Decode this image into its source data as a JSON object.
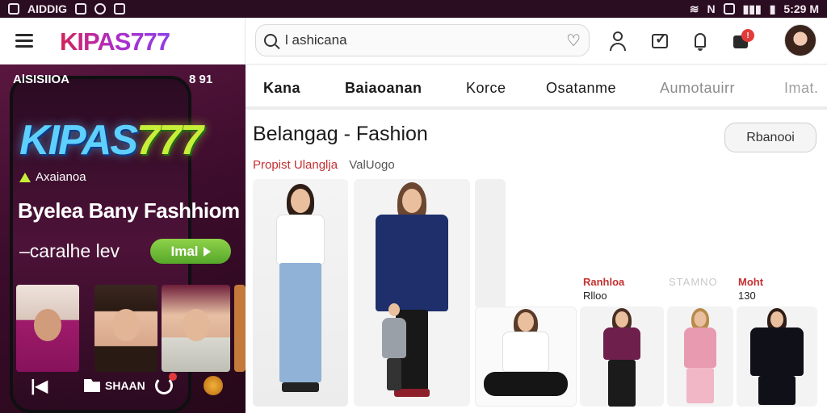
{
  "status_bar": {
    "left_text": "AIDDIG",
    "time": "5:29 M"
  },
  "app": {
    "brand": "KIPAS777"
  },
  "search": {
    "value": "l ashicana",
    "placeholder": ""
  },
  "toolbar": {
    "cart_badge": "!"
  },
  "promo": {
    "phone_label": "AlSISIIOA",
    "phone_time": "8 91",
    "brand_main": "KIPAS",
    "brand_sevens": "777",
    "tagline": "Axaianoa",
    "headline": "Byelea Bany Fashhiom",
    "subline": "–caralhe lev",
    "cta_label": "Imal",
    "share_label": "SHAAN"
  },
  "tabs": [
    {
      "label": "Kana",
      "style": "bold"
    },
    {
      "label": "Baiaoanan",
      "style": "bold"
    },
    {
      "label": "Korce",
      "style": "normal"
    },
    {
      "label": "Osatanme",
      "style": "normal"
    },
    {
      "label": "Aumotauirr",
      "style": "dim"
    },
    {
      "label": "Imat.",
      "style": "faded"
    }
  ],
  "main": {
    "title": "Belangag - Fashion",
    "filter_label": "Rbanooi",
    "sub_red": "Propist Ulanglja",
    "sub_gray": "ValUogo"
  },
  "products": {
    "tag_a": "Ranhloa",
    "price_a": "Rlloo",
    "tag_b": "Moht",
    "price_b": "130",
    "tag_ghost": "STAMNO"
  },
  "colors": {
    "status_bar_bg": "#2b0d22",
    "brand_gradient_start": "#d3235a",
    "brand_gradient_end": "#8e3ee6",
    "promo_bg": "#4d1238",
    "cta_green": "#6fbf36",
    "accent_red": "#c53030"
  }
}
